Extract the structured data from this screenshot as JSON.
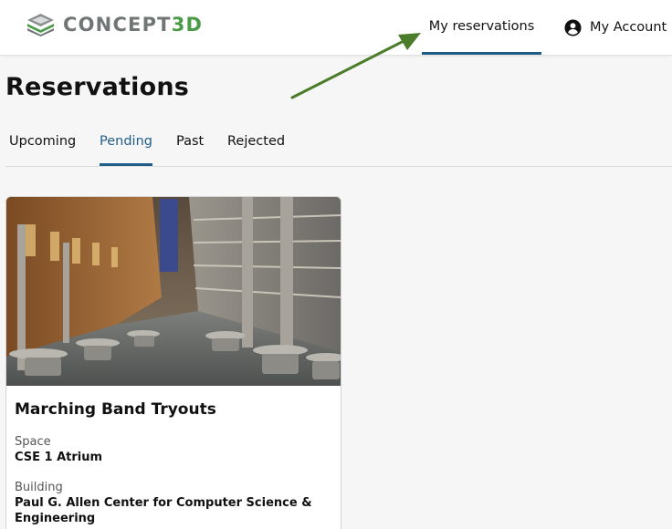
{
  "header": {
    "logo": {
      "name": "Concept3D",
      "text_main": "CONCEPT",
      "text_accent": "3D"
    },
    "nav": {
      "reservations_label": "My reservations",
      "account_label": "My Account"
    }
  },
  "page": {
    "title": "Reservations"
  },
  "tabs": [
    {
      "label": "Upcoming",
      "active": false
    },
    {
      "label": "Pending",
      "active": true
    },
    {
      "label": "Past",
      "active": false
    },
    {
      "label": "Rejected",
      "active": false
    }
  ],
  "reservation_card": {
    "image": "atrium-photo",
    "title": "Marching Band Tryouts",
    "space_label": "Space",
    "space_value": "CSE 1 Atrium",
    "building_label": "Building",
    "building_value": "Paul G. Allen Center for Computer Science & Engineering"
  },
  "colors": {
    "accent_blue": "#1f5d86",
    "logo_green": "#4a9a49",
    "logo_gray": "#707575",
    "annotation_arrow": "#4a7c2a"
  },
  "icons": {
    "account": "account-circle-icon",
    "annotation": "arrow-pointer-icon"
  }
}
